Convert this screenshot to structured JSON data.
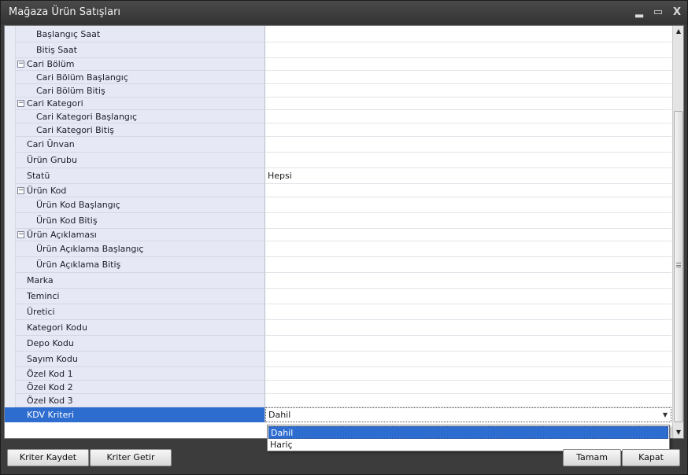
{
  "window": {
    "title": "Mağaza Ürün Satışları"
  },
  "controls": {
    "minimize": "▂",
    "maximize": "▭",
    "close": "X"
  },
  "rows": [
    {
      "label": "Başlangıç Saat",
      "value": "",
      "level": 1,
      "group": false
    },
    {
      "label": "Bitiş Saat",
      "value": "",
      "level": 1,
      "group": false
    },
    {
      "label": "Cari Bölüm",
      "value": "",
      "level": 0,
      "group": true
    },
    {
      "label": "Cari Bölüm Başlangıç",
      "value": "",
      "level": 1,
      "group": false
    },
    {
      "label": "Cari Bölüm Bitiş",
      "value": "",
      "level": 1,
      "group": false
    },
    {
      "label": "Cari Kategori",
      "value": "",
      "level": 0,
      "group": true
    },
    {
      "label": "Cari Kategori Başlangıç",
      "value": "",
      "level": 1,
      "group": false
    },
    {
      "label": "Cari Kategori Bitiş",
      "value": "",
      "level": 1,
      "group": false
    },
    {
      "label": "Cari Ünvan",
      "value": "",
      "level": 0,
      "group": false
    },
    {
      "label": "Ürün Grubu",
      "value": "",
      "level": 0,
      "group": false
    },
    {
      "label": "Statü",
      "value": "Hepsi",
      "level": 0,
      "group": false
    },
    {
      "label": "Ürün Kod",
      "value": "",
      "level": 0,
      "group": true
    },
    {
      "label": "Ürün Kod Başlangıç",
      "value": "",
      "level": 1,
      "group": false
    },
    {
      "label": "Ürün Kod Bitiş",
      "value": "",
      "level": 1,
      "group": false
    },
    {
      "label": "Ürün Açıklaması",
      "value": "",
      "level": 0,
      "group": true
    },
    {
      "label": "Ürün Açıklama Başlangıç",
      "value": "",
      "level": 1,
      "group": false
    },
    {
      "label": "Ürün Açıklama Bitiş",
      "value": "",
      "level": 1,
      "group": false
    },
    {
      "label": "Marka",
      "value": "",
      "level": 0,
      "group": false
    },
    {
      "label": "Teminci",
      "value": "",
      "level": 0,
      "group": false
    },
    {
      "label": "Üretici",
      "value": "",
      "level": 0,
      "group": false
    },
    {
      "label": "Kategori Kodu",
      "value": "",
      "level": 0,
      "group": false
    },
    {
      "label": "Depo Kodu",
      "value": "",
      "level": 0,
      "group": false
    },
    {
      "label": "Sayım Kodu",
      "value": "",
      "level": 0,
      "group": false
    },
    {
      "label": "Özel Kod 1",
      "value": "",
      "level": 0,
      "group": false
    },
    {
      "label": "Özel Kod 2",
      "value": "",
      "level": 0,
      "group": false
    },
    {
      "label": "Özel Kod 3",
      "value": "",
      "level": 0,
      "group": false
    },
    {
      "label": "KDV Kriteri",
      "value": "Dahil",
      "level": 0,
      "group": false,
      "selected": true
    }
  ],
  "dropdown": {
    "options": [
      "Dahil",
      "Hariç"
    ],
    "selected": "Dahil"
  },
  "buttons": {
    "save": "Kriter Kaydet",
    "get": "Kriter Getir",
    "ok": "Tamam",
    "close": "Kapat"
  },
  "colors": {
    "selection": "#2e6dd0",
    "name_column": "#e6e9f5",
    "title_bar": "#3c3c3c"
  }
}
